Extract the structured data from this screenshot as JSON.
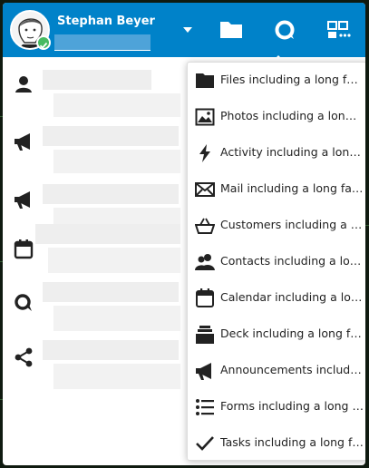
{
  "user": {
    "name": "Stephan Beyer"
  },
  "menu": {
    "items": [
      {
        "label": "Files including a long fake name",
        "icon": "folder-icon"
      },
      {
        "label": "Photos including a long fake name",
        "icon": "image-icon"
      },
      {
        "label": "Activity including a long fake name",
        "icon": "lightning-icon"
      },
      {
        "label": "Mail including a long fake name",
        "icon": "mail-icon"
      },
      {
        "label": "Customers including a long fake name",
        "icon": "basket-icon"
      },
      {
        "label": "Contacts including a long fake name",
        "icon": "contacts-icon"
      },
      {
        "label": "Calendar including a long fake name",
        "icon": "calendar-icon"
      },
      {
        "label": "Deck including a long fake name",
        "icon": "deck-icon"
      },
      {
        "label": "Announcements including a long fake name",
        "icon": "megaphone-icon"
      },
      {
        "label": "Forms including a long fake name",
        "icon": "list-icon"
      },
      {
        "label": "Tasks including a long fake name",
        "icon": "checkmark-icon"
      }
    ]
  },
  "colors": {
    "header": "#0082c9",
    "status_online": "#46ba61"
  }
}
